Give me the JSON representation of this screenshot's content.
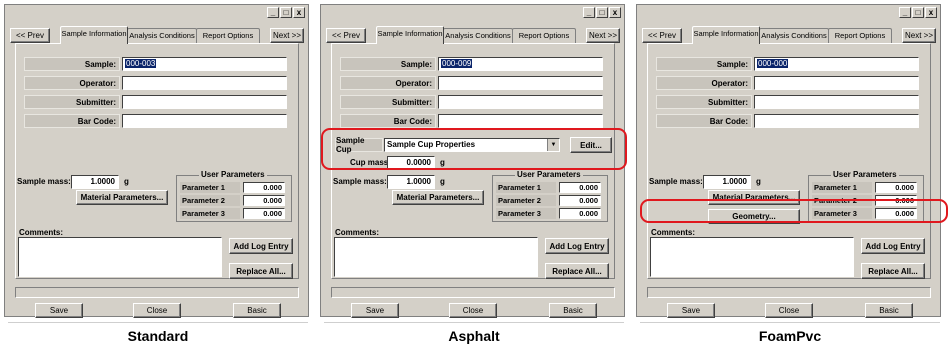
{
  "window_controls": {
    "minimize": "_",
    "maximize": "□",
    "close": "x"
  },
  "nav": {
    "prev": "<< Prev",
    "next": "Next >>"
  },
  "tabs": [
    "Sample Information",
    "Analysis Conditions",
    "Report Options"
  ],
  "labels": {
    "sample": "Sample:",
    "operator": "Operator:",
    "submitter": "Submitter:",
    "bar_code": "Bar Code:",
    "sample_mass": "Sample mass:",
    "unit_g": "g",
    "user_parameters": "User Parameters",
    "comments": "Comments:",
    "sample_cup": "Sample Cup",
    "cup_mass": "Cup mass:"
  },
  "buttons": {
    "material_parameters": "Material Parameters...",
    "add_log_entry": "Add Log Entry",
    "replace_all": "Replace All...",
    "save": "Save",
    "close": "Close",
    "basic": "Basic",
    "edit": "Edit...",
    "geometry": "Geometry..."
  },
  "panels": [
    {
      "id": "standard",
      "caption": "Standard",
      "sample_value": "000-003",
      "sample_mass": "1.0000",
      "parameters": [
        {
          "label": "Parameter 1",
          "value": "0.000"
        },
        {
          "label": "Parameter 2",
          "value": "0.000"
        },
        {
          "label": "Parameter 3",
          "value": "0.000"
        }
      ]
    },
    {
      "id": "asphalt",
      "caption": "Asphalt",
      "sample_value": "000-009",
      "sample_cup_value": "Sample Cup Properties",
      "cup_mass": "0.0000",
      "sample_mass": "1.0000",
      "parameters": [
        {
          "label": "Parameter 1",
          "value": "0.000"
        },
        {
          "label": "Parameter 2",
          "value": "0.000"
        },
        {
          "label": "Parameter 3",
          "value": "0.000"
        }
      ]
    },
    {
      "id": "foampvc",
      "caption": "FoamPvc",
      "sample_value": "000-000",
      "sample_mass": "1.0000",
      "parameters": [
        {
          "label": "Parameter 1",
          "value": "0.000"
        },
        {
          "label": "Parameter 2",
          "value": "0.000"
        },
        {
          "label": "Parameter 3",
          "value": "0.000"
        }
      ]
    }
  ],
  "colors": {
    "dialog_bg": "#d4d0c8",
    "selection": "#0a246a",
    "highlight": "#e0181e"
  }
}
